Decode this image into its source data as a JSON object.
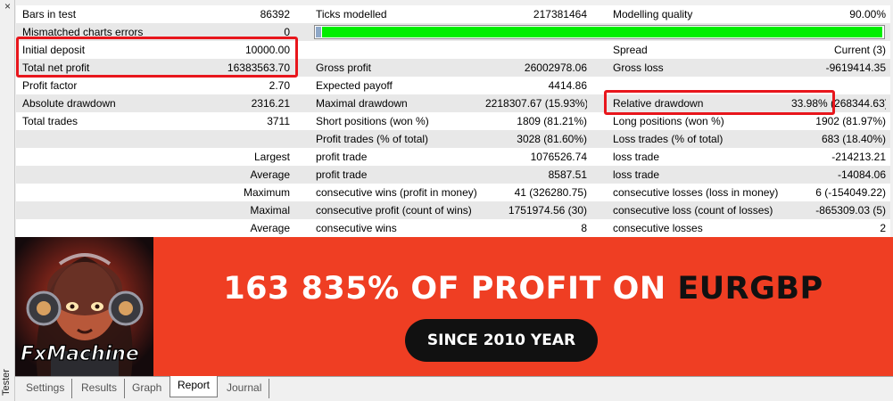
{
  "window": {
    "side_label": "Tester",
    "close_glyph": "×"
  },
  "report": {
    "rows": [
      {
        "c1": "Bars in test",
        "c2": "86392",
        "c3": "Ticks modelled",
        "c4": "217381464",
        "c5": "Modelling quality",
        "c6": "90.00%"
      },
      {
        "c1": "Mismatched charts errors",
        "c2": "0"
      },
      {
        "c1": "Initial deposit",
        "c2": "10000.00",
        "c5": "Spread",
        "c6": "Current (3)"
      },
      {
        "c1": "Total net profit",
        "c2": "16383563.70",
        "c3": "Gross profit",
        "c4": "26002978.06",
        "c5": "Gross loss",
        "c6": "-9619414.35"
      },
      {
        "c1": "Profit factor",
        "c2": "2.70",
        "c3": "Expected payoff",
        "c4": "4414.86"
      },
      {
        "c1": "Absolute drawdown",
        "c2": "2316.21",
        "c3": "Maximal drawdown",
        "c4": "2218307.67 (15.93%)",
        "c5": "Relative drawdown",
        "c6": "33.98% (268344.63)"
      },
      {
        "c1": "Total trades",
        "c2": "3711",
        "c3": "Short positions (won %)",
        "c4": "1809 (81.21%)",
        "c5": "Long positions (won %)",
        "c6": "1902 (81.97%)"
      },
      {
        "c3": "Profit trades (% of total)",
        "c4": "3028 (81.60%)",
        "c5": "Loss trades (% of total)",
        "c6": "683 (18.40%)"
      },
      {
        "c1r": "Largest",
        "c3": "profit trade",
        "c4": "1076526.74",
        "c5": "loss trade",
        "c6": "-214213.21"
      },
      {
        "c1r": "Average",
        "c3": "profit trade",
        "c4": "8587.51",
        "c5": "loss trade",
        "c6": "-14084.06"
      },
      {
        "c1r": "Maximum",
        "c3": "consecutive wins (profit in money)",
        "c4": "41 (326280.75)",
        "c5": "consecutive losses (loss in money)",
        "c6": "6 (-154049.22)"
      },
      {
        "c1r": "Maximal",
        "c3": "consecutive profit (count of wins)",
        "c4": "1751974.56 (30)",
        "c5": "consecutive loss (count of losses)",
        "c6": "-865309.03 (5)"
      },
      {
        "c1r": "Average",
        "c3": "consecutive wins",
        "c4": "8",
        "c5": "consecutive losses",
        "c6": "2"
      }
    ],
    "modelling_quality_fraction": 0.9,
    "highlight_color": "#e8161c"
  },
  "banner": {
    "headline_main": "163 835% OF PROFIT ON ",
    "headline_accent": "EURGBP",
    "pill_label": "SINCE 2010 YEAR",
    "logo_text": "FxMachine",
    "background_color": "#ef3e23"
  },
  "tabs": [
    {
      "label": "Settings",
      "active": false
    },
    {
      "label": "Results",
      "active": false
    },
    {
      "label": "Graph",
      "active": false
    },
    {
      "label": "Report",
      "active": true
    },
    {
      "label": "Journal",
      "active": false
    }
  ]
}
